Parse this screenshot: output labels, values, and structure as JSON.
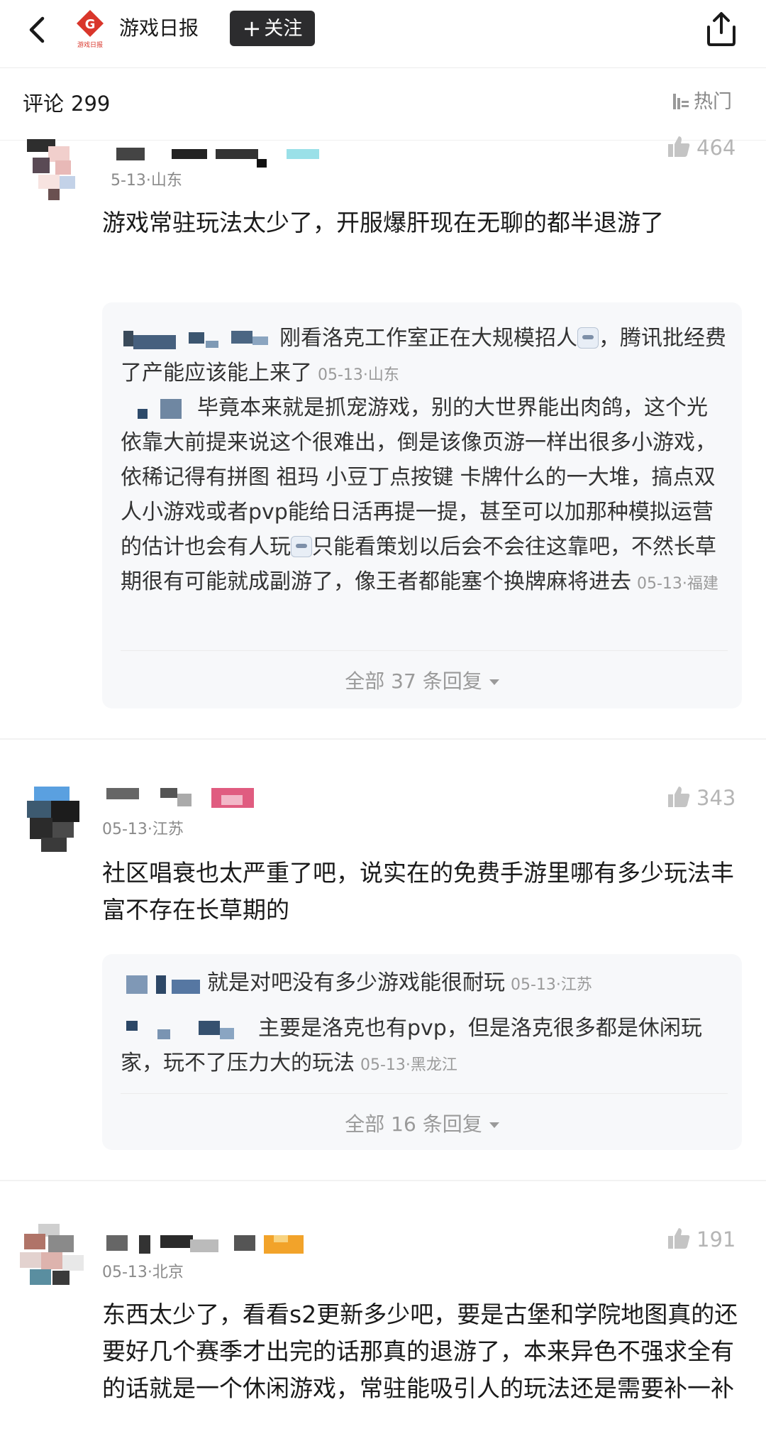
{
  "header": {
    "account_name": "游戏日报",
    "logo_letter": "G",
    "logo_caption": "游戏日报",
    "follow_label": "关注",
    "follow_plus": "+"
  },
  "subheader": {
    "label": "评论",
    "count": "299",
    "sort_label": "热门"
  },
  "comments": [
    {
      "meta": "5-13·山东",
      "likes": "464",
      "text": "游戏常驻玩法太少了，开服爆肝现在无聊的都半退游了",
      "replies": [
        {
          "text": "刚看洛克工作室正在大规模招人",
          "text_after": "，腾讯批经费了产能应该能上来了",
          "meta": "05-13·山东"
        },
        {
          "text": "毕竟本来就是抓宠游戏，别的大世界能出肉鸽，这个光依靠大前提来说这个很难出，倒是该像页游一样出很多小游戏，依稀记得有拼图 祖玛 小豆丁点按键 卡牌什么的一大堆，搞点双人小游戏或者pvp能给日活再提一提，甚至可以加那种模拟运营的估计也会有人玩",
          "text_after": "只能看策划以后会不会往这靠吧，不然长草期很有可能就成副游了，像王者都能塞个换牌麻将进去",
          "meta": "05-13·福建"
        }
      ],
      "more_replies": "全部 37 条回复"
    },
    {
      "meta": "05-13·江苏",
      "likes": "343",
      "text": "社区唱衰也太严重了吧，说实在的免费手游里哪有多少玩法丰富不存在长草期的",
      "replies": [
        {
          "text": "就是对吧没有多少游戏能很耐玩",
          "meta": "05-13·江苏"
        },
        {
          "text": "主要是洛克也有pvp，但是洛克很多都是休闲玩家，玩不了压力大的玩法",
          "meta": "05-13·黑龙江"
        }
      ],
      "more_replies": "全部 16 条回复"
    },
    {
      "meta": "05-13·北京",
      "likes": "191",
      "text": "东西太少了，看看s2更新多少吧，要是古堡和学院地图真的还要好几个赛季才出完的话那真的退游了，本来异色不强求全有的话就是一个休闲游戏，常驻能吸引人的玩法还是需要补一补"
    }
  ],
  "colors": {
    "follow_bg": "#2c2c2e",
    "logo_red": "#d9362b",
    "muted": "#8a8a8a",
    "reply_bg": "#f7f8fa"
  }
}
